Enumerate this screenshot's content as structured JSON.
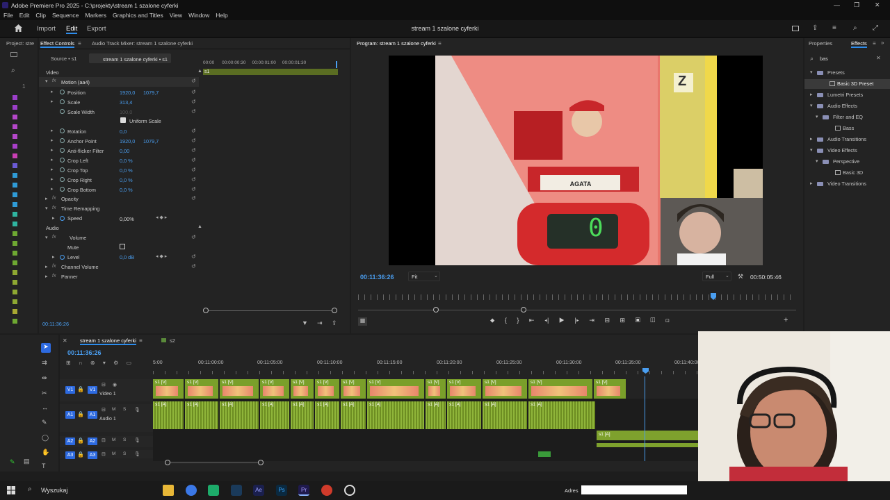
{
  "app": {
    "title": "Adobe Premiere Pro 2025 - C:\\projekty\\stream 1 szalone cyferki",
    "menu": [
      "File",
      "Edit",
      "Clip",
      "Sequence",
      "Markers",
      "Graphics and Titles",
      "View",
      "Window",
      "Help"
    ],
    "workspace_tabs": [
      "Import",
      "Edit",
      "Export"
    ],
    "active_workspace": "Edit",
    "project_name": "stream 1 szalone cyferki"
  },
  "left_panel": {
    "tabs": [
      "Project: stre",
      "Effect Controls",
      "Audio Track Mixer: stream 1 szalone cyferki"
    ],
    "source_tab": "Source • s1",
    "sequence_tab": "stream 1 szalone cyferki • s1",
    "clip_label": "s1",
    "ruler": [
      "00:00",
      "00:00:00:30",
      "00:00:01:00",
      "00:00:01:30"
    ],
    "section_video": "Video",
    "section_audio": "Audio",
    "motion": "Motion (aa4)",
    "props": [
      {
        "label": "Position",
        "v1": "1920,0",
        "v2": "1079,7"
      },
      {
        "label": "Scale",
        "v1": "313,4",
        "v2": ""
      },
      {
        "label": "Scale Width",
        "v1": "100,0",
        "v2": ""
      },
      {
        "label": "Rotation",
        "v1": "0,0",
        "v2": ""
      },
      {
        "label": "Anchor Point",
        "v1": "1920,0",
        "v2": "1079,7"
      },
      {
        "label": "Anti-flicker Filter",
        "v1": "0,00",
        "v2": ""
      },
      {
        "label": "Crop Left",
        "v1": "0,0 %",
        "v2": ""
      },
      {
        "label": "Crop Top",
        "v1": "0,0 %",
        "v2": ""
      },
      {
        "label": "Crop Right",
        "v1": "0,0 %",
        "v2": ""
      },
      {
        "label": "Crop Bottom",
        "v1": "0,0 %",
        "v2": ""
      }
    ],
    "uniform_scale": "Uniform Scale",
    "opacity": "Opacity",
    "time_remapping": "Time Remapping",
    "speed_label": "Speed",
    "speed_value": "0,00%",
    "volume": "Volume",
    "mute": "Mute",
    "level_label": "Level",
    "level_value": "0,0 dB",
    "channel_volume": "Channel Volume",
    "panner": "Panner",
    "timecode": "00:11:36:26"
  },
  "program": {
    "title": "Program: stream 1 szalone cyferki",
    "timecode": "00:11:36:26",
    "fit": "Fit",
    "quality": "Full",
    "duration": "00:50:05:46",
    "name_plate": "AGATA",
    "digit": "0",
    "corner_letter": "Z"
  },
  "right_panel": {
    "tabs": [
      "Properties",
      "Effects"
    ],
    "search_value": "bas",
    "tree": [
      {
        "label": "Presets",
        "indent": 0,
        "type": "folder",
        "open": true
      },
      {
        "label": "Basic 3D Preset",
        "indent": 1,
        "type": "preset",
        "selected": true
      },
      {
        "label": "Lumetri Presets",
        "indent": 0,
        "type": "folder",
        "open": false
      },
      {
        "label": "Audio Effects",
        "indent": 0,
        "type": "folder",
        "open": true
      },
      {
        "label": "Filter and EQ",
        "indent": 1,
        "type": "folder",
        "open": true
      },
      {
        "label": "Bass",
        "indent": 2,
        "type": "effect"
      },
      {
        "label": "Audio Transitions",
        "indent": 0,
        "type": "folder",
        "open": false
      },
      {
        "label": "Video Effects",
        "indent": 0,
        "type": "folder",
        "open": true
      },
      {
        "label": "Perspective",
        "indent": 1,
        "type": "folder",
        "open": true
      },
      {
        "label": "Basic 3D",
        "indent": 2,
        "type": "effect"
      },
      {
        "label": "Video Transitions",
        "indent": 0,
        "type": "folder",
        "open": false
      }
    ]
  },
  "timeline": {
    "tabs": [
      "stream 1 szalone cyferki",
      "s2"
    ],
    "timecode": "00:11:36:26",
    "ruler": [
      "5:00",
      "00:11:00:00",
      "00:11:05:00",
      "00:11:10:00",
      "00:11:15:00",
      "00:11:20:00",
      "00:11:25:00",
      "00:11:30:00",
      "00:11:35:00",
      "00:11:40:00"
    ],
    "tracks": [
      {
        "id": "V1",
        "name": "Video 1"
      },
      {
        "id": "A1",
        "name": "Audio 1"
      },
      {
        "id": "A2",
        "name": ""
      },
      {
        "id": "A3",
        "name": ""
      }
    ],
    "clip_v": "s1 [V]",
    "clip_a": "s1 [A]"
  },
  "taskbar": {
    "search": "Wyszukaj",
    "address_label": "Adres"
  }
}
